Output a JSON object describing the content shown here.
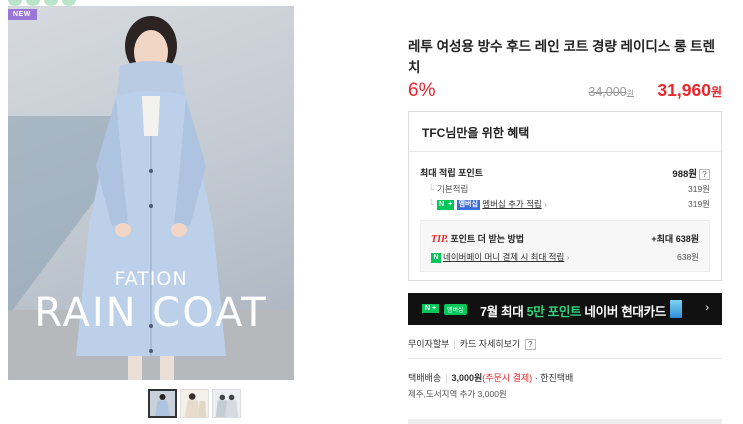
{
  "badge": {
    "label": "NEW"
  },
  "hero": {
    "subtitle": "FATION",
    "title": "RAIN COAT"
  },
  "product": {
    "title": "레투 여성용 방수 후드 레인 코트 경량 레이디스 롱 트렌치",
    "discount": "6%",
    "original_price": "34,000",
    "original_unit": "원",
    "sale_price": "31,960",
    "sale_unit": "원"
  },
  "benefit": {
    "heading": "TFC님만을 위한 혜택",
    "total_label": "최대 적립 포인트",
    "total_value": "988원",
    "qmark": "?",
    "base_label": "기본적립",
    "base_value": "319원",
    "member_badge_n": "N",
    "member_badge_plus": "+",
    "member_badge_text": "멤버십",
    "member_label": "멤버십 추가 적립",
    "member_chevron": "›",
    "member_value": "319원",
    "tip_prefix": "TIP.",
    "tip_title": "포인트 더 받는 방법",
    "tip_max": "+최대 638원",
    "npay_icon": "N",
    "tip_row_label": "네이버페이 머니 결제 시 최대 적립",
    "tip_row_chevron": "›",
    "tip_row_value": "638원"
  },
  "banner": {
    "n_label": "N +",
    "membership_label": "멤버십",
    "text_prefix": "7월 최대 ",
    "text_highlight": "5만 포인트",
    "text_suffix": " 네이버 현대카드",
    "arrow": "›"
  },
  "installment": {
    "label": "무이자할부",
    "card_info": "카드 자세히보기",
    "qmark": "?"
  },
  "shipping": {
    "type": "택배배송",
    "fee": "3,000원",
    "condition": "(주문시 결제)",
    "carrier": "· 한진택배",
    "extra": "제주,도서지역 추가 3,000원"
  },
  "colors": {
    "accent_red": "#e8262c",
    "naver_green": "#03c75a",
    "new_badge": "#9a76d6",
    "banner_bg": "#111111"
  },
  "thumbnails": [
    {
      "icon": "raincoat-front-thumb"
    },
    {
      "icon": "raincoat-beige-thumb"
    },
    {
      "icon": "raincoat-gray-thumb"
    }
  ]
}
